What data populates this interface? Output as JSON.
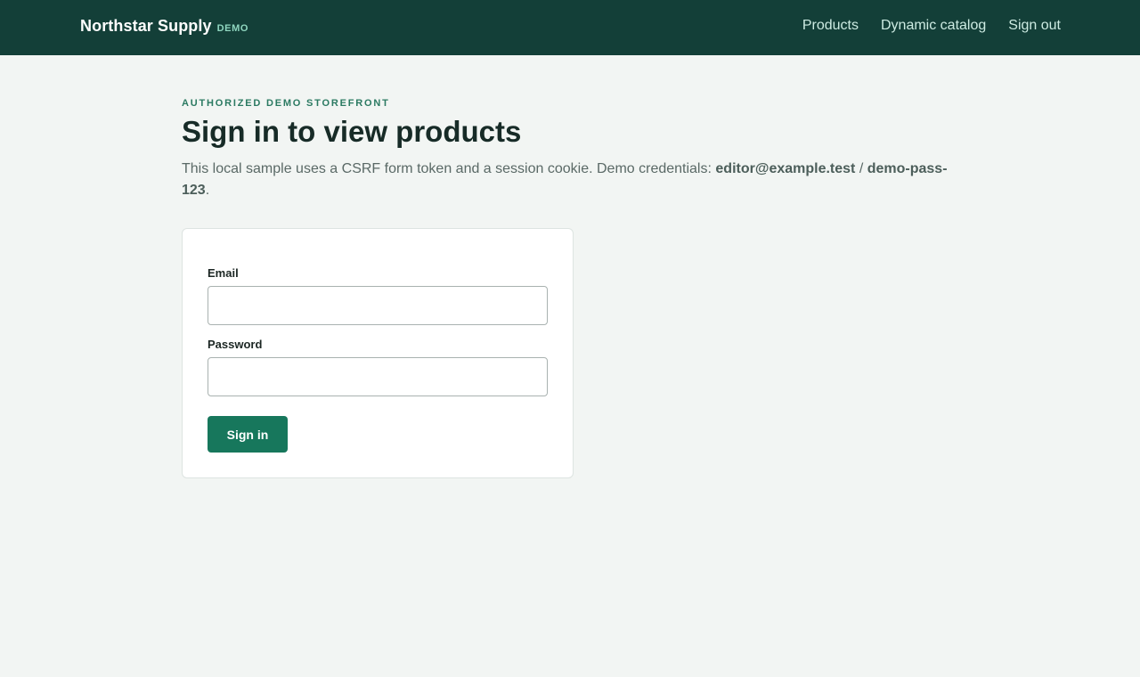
{
  "header": {
    "brand_name": "Northstar Supply",
    "brand_tag": "DEMO",
    "nav": [
      {
        "label": "Products"
      },
      {
        "label": "Dynamic catalog"
      },
      {
        "label": "Sign out"
      }
    ]
  },
  "main": {
    "eyebrow": "AUTHORIZED DEMO STOREFRONT",
    "title": "Sign in to view products",
    "intro_prefix": "This local sample uses a CSRF form token and a session cookie. Demo credentials:",
    "demo_email": "editor@example.test",
    "separator": "/",
    "demo_password": "demo-pass-123",
    "intro_suffix": "."
  },
  "form": {
    "email_label": "Email",
    "email_value": "",
    "password_label": "Password",
    "password_value": "",
    "submit_label": "Sign in"
  },
  "colors": {
    "header_bg": "#133f38",
    "accent": "#17775c",
    "eyebrow": "#2b7a62",
    "page_bg": "#f2f5f3"
  }
}
